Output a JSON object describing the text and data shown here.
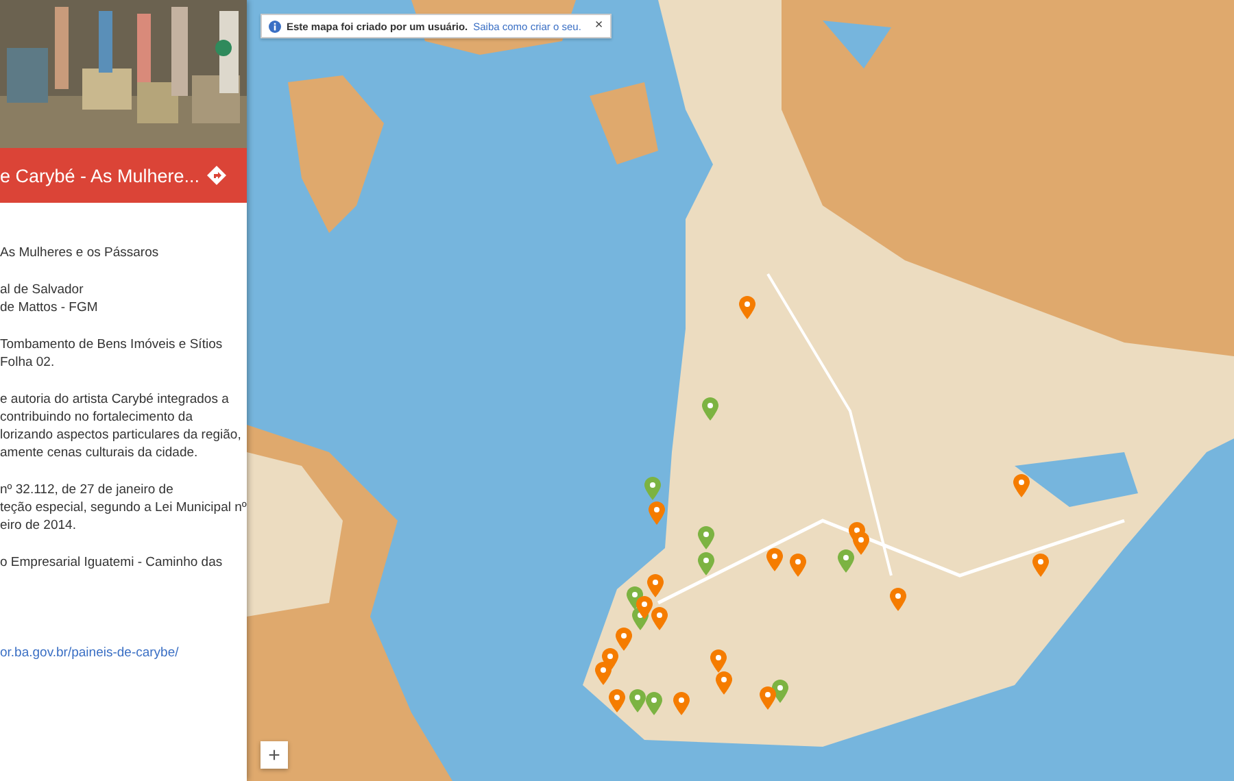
{
  "panel": {
    "header": {
      "title": "e Carybé - As Mulhere..."
    },
    "paragraphs": [
      [
        "As Mulheres e os Pássaros"
      ],
      [
        "al de Salvador",
        "de Mattos - FGM"
      ],
      [
        "Tombamento de Bens Imóveis e Sítios",
        "Folha 02."
      ],
      [
        "e autoria do artista Carybé integrados a",
        "contribuindo no fortalecimento da",
        "lorizando aspectos particulares da região,",
        "amente cenas culturais da cidade."
      ],
      [
        "nº 32.112, de 27 de janeiro de",
        "teção especial, segundo a Lei Municipal nº",
        "eiro de 2014."
      ],
      [
        "o Empresarial Iguatemi - Caminho das"
      ]
    ],
    "link": "or.ba.gov.br/paineis-de-carybe/"
  },
  "map": {
    "banner": {
      "text": "Este mapa foi criado por um usuário.",
      "link": "Saiba como criar o seu.",
      "close": "×"
    },
    "zoom_in": "+",
    "markers": [
      {
        "color": "#f57c00"
      },
      {
        "color": "#7cb342"
      },
      {
        "color": "#7cb342"
      },
      {
        "color": "#7cb342"
      },
      {
        "color": "#f57c00"
      },
      {
        "color": "#7cb342"
      },
      {
        "color": "#7cb342"
      },
      {
        "color": "#f57c00"
      },
      {
        "color": "#f57c00"
      },
      {
        "color": "#f57c00"
      },
      {
        "color": "#7cb342"
      },
      {
        "color": "#f57c00"
      },
      {
        "color": "#f57c00"
      },
      {
        "color": "#f57c00"
      },
      {
        "color": "#f57c00"
      },
      {
        "color": "#f57c00"
      },
      {
        "color": "#7cb342"
      },
      {
        "color": "#f57c00"
      },
      {
        "color": "#f57c00"
      },
      {
        "color": "#f57c00"
      },
      {
        "color": "#f57c00"
      },
      {
        "color": "#f57c00"
      },
      {
        "color": "#f57c00"
      },
      {
        "color": "#7cb342"
      },
      {
        "color": "#f57c00"
      },
      {
        "color": "#7cb342"
      },
      {
        "color": "#f57c00"
      },
      {
        "color": "#f57c00"
      },
      {
        "color": "#7cb342"
      },
      {
        "color": "#f57c00"
      }
    ]
  }
}
